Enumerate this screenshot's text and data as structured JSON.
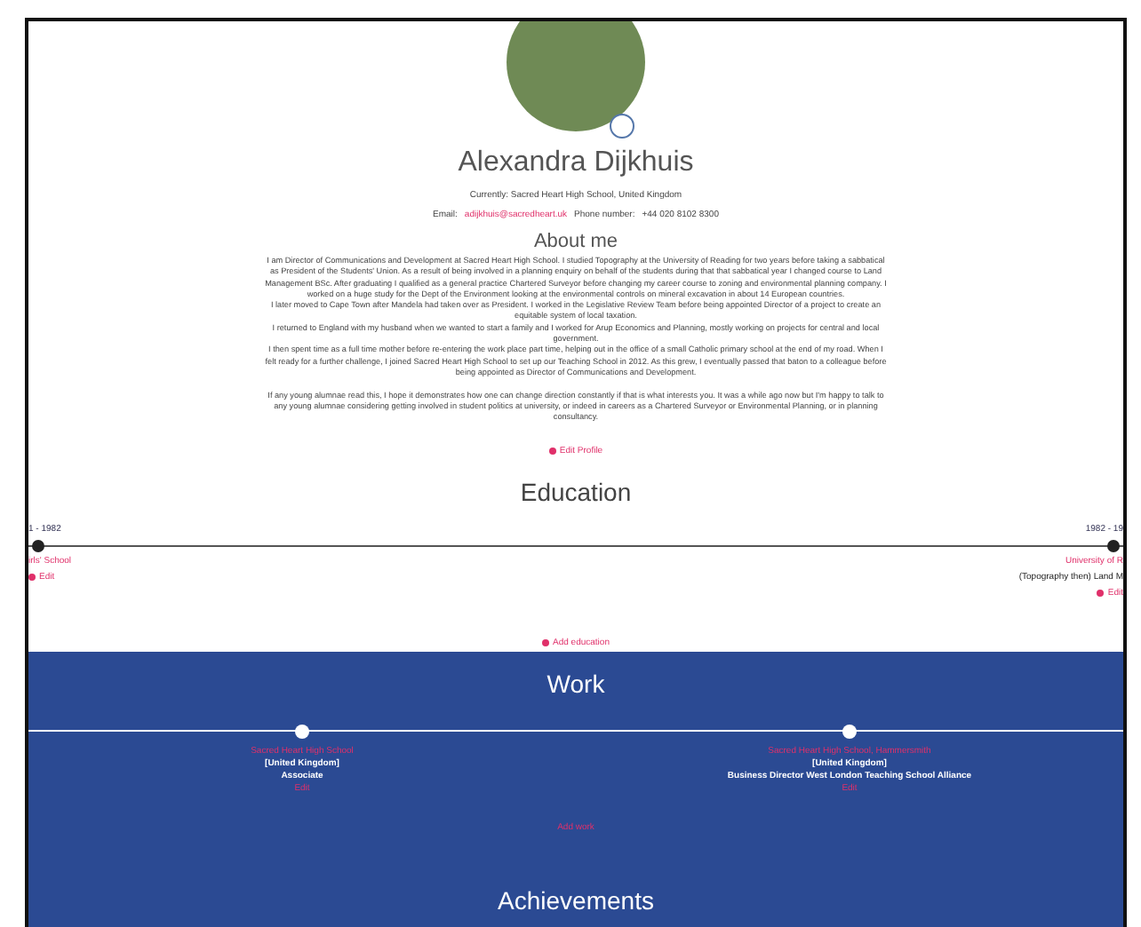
{
  "profile": {
    "name": "Alexandra Dijkhuis",
    "subtitle": "Currently: Sacred Heart High School, United Kingdom",
    "email_label": "Email:",
    "email": "adijkhuis@sacredheart.uk",
    "phone_label": "Phone number:",
    "phone": "+44 020 8102 8300"
  },
  "about": {
    "heading": "About me",
    "paragraphs": [
      "I am Director of Communications and Development at Sacred Heart High School. I studied Topography at the University of Reading for two years before taking a sabbatical as President of the Students' Union. As a result of being involved in a planning enquiry on behalf of the students during that that sabbatical year I changed course to Land Management BSc. After graduating I qualified as a general practice Chartered Surveyor before changing my career course to zoning and environmental planning company. I worked on a huge study for the Dept of the Environment looking at the environmental controls on mineral excavation in about 14 European countries.",
      "I later moved to Cape Town after Mandela had taken over as President. I worked in the Legislative Review Team before being appointed Director of a project to create an equitable system of local taxation.",
      "I returned to England with my husband when we wanted to start a family and I worked for Arup Economics and Planning, mostly working on projects for central and local government.",
      "I then spent time as a full time mother before re-entering the work place part time, helping out in the office of a small Catholic primary school at the end of my road. When I felt ready for a further challenge, I joined Sacred Heart High School to set up our Teaching School in 2012. As this grew, I eventually passed that baton to a colleague before being appointed as Director of Communications and Development.",
      "If any young alumnae read this, I hope it demonstrates how one can change direction constantly if that is what interests you. It was a while ago now but I'm happy to talk to any young alumnae considering getting involved in student politics at university, or indeed in careers as a Chartered Surveyor or Environmental Planning, or in planning consultancy."
    ],
    "edit": "Edit Profile"
  },
  "education": {
    "heading": "Education",
    "items": [
      {
        "dates": "1 - 1982",
        "school": "irls' School",
        "edit": "Edit"
      },
      {
        "dates": "1982 - 19",
        "school": "University of R",
        "subject": "(Topography then) Land M",
        "edit": "Edit"
      }
    ],
    "add": "Add education"
  },
  "work": {
    "heading": "Work",
    "items": [
      {
        "title": "Sacred Heart High School",
        "location": "[United Kingdom]",
        "role": "Associate",
        "edit": "Edit"
      },
      {
        "title": "Sacred Heart High School, Hammersmith",
        "location": "[United Kingdom]",
        "role": "Business Director West London Teaching School Alliance",
        "edit": "Edit"
      }
    ],
    "add": "Add work"
  },
  "achievements": {
    "heading": "Achievements"
  }
}
